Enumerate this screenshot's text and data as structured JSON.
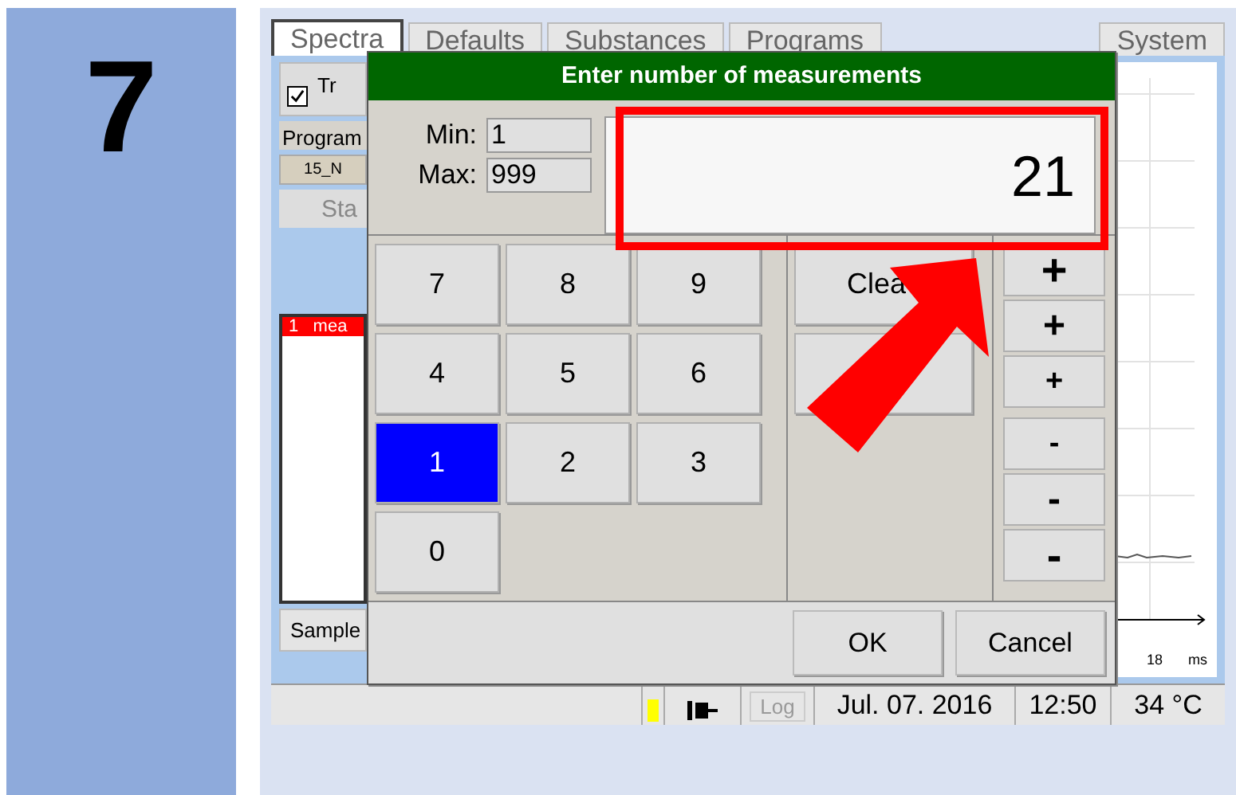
{
  "step_number": "7",
  "tabs": [
    {
      "label": "Spectra",
      "selected": true
    },
    {
      "label": "Defaults",
      "selected": false
    },
    {
      "label": "Substances",
      "selected": false
    },
    {
      "label": "Programs",
      "selected": false
    },
    {
      "label": "System",
      "selected": false
    }
  ],
  "left_panel": {
    "checkbox": {
      "label": "Tr",
      "checked": true
    },
    "program_label": "Program",
    "program_value": "15_N",
    "start_button": "Sta",
    "list_rows": [
      {
        "index": "1",
        "name": "mea",
        "selected": true
      }
    ],
    "sample_button": "Sample"
  },
  "chart_axis": {
    "tick": "18",
    "unit": "ms"
  },
  "status_bar": {
    "log_button": {
      "label": "Log",
      "disabled": true
    },
    "date": "Jul. 07. 2016",
    "time": "12:50",
    "temperature": "34 °C"
  },
  "dialog": {
    "title": "Enter number of measurements",
    "min_label": "Min:",
    "min_value": "1",
    "max_label": "Max:",
    "max_value": "999",
    "display_value": "21",
    "keys": [
      {
        "label": "7",
        "selected": false
      },
      {
        "label": "8",
        "selected": false
      },
      {
        "label": "9",
        "selected": false
      },
      {
        "label": "4",
        "selected": false
      },
      {
        "label": "5",
        "selected": false
      },
      {
        "label": "6",
        "selected": false
      },
      {
        "label": "1",
        "selected": true
      },
      {
        "label": "2",
        "selected": false
      },
      {
        "label": "3",
        "selected": false
      },
      {
        "label": "0",
        "selected": false
      }
    ],
    "side_buttons": [
      "Clea"
    ],
    "step_buttons": [
      "+",
      "+",
      "+",
      "-",
      "-",
      "-"
    ],
    "buttons": [
      "OK",
      "Cancel"
    ]
  }
}
